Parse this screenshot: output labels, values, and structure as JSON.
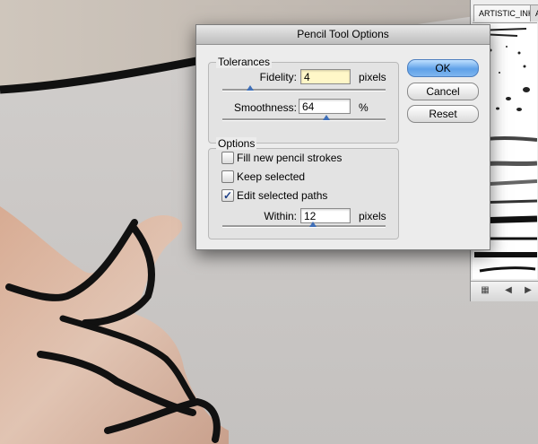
{
  "dialog": {
    "title": "Pencil Tool Options",
    "tolerances": {
      "group_label": "Tolerances",
      "fidelity": {
        "label": "Fidelity:",
        "value": "4",
        "unit": "pixels"
      },
      "smoothness": {
        "label": "Smoothness:",
        "value": "64",
        "unit": "%"
      }
    },
    "options": {
      "group_label": "Options",
      "fill_new_strokes": {
        "label": "Fill new pencil strokes",
        "checked": false
      },
      "keep_selected": {
        "label": "Keep selected",
        "checked": false
      },
      "edit_selected_paths": {
        "label": "Edit selected paths",
        "checked": true
      },
      "within": {
        "label": "Within:",
        "value": "12",
        "unit": "pixels"
      }
    },
    "buttons": {
      "ok": "OK",
      "cancel": "Cancel",
      "reset": "Reset"
    }
  },
  "brush_panel": {
    "tabs": [
      "ARTISTIC_INK",
      "A"
    ],
    "footer_icons": [
      "brush-library-icon",
      "previous-arrow-icon",
      "next-arrow-icon"
    ]
  },
  "colors": {
    "accent": "#5fa1e8",
    "check": "#1c3f86"
  }
}
